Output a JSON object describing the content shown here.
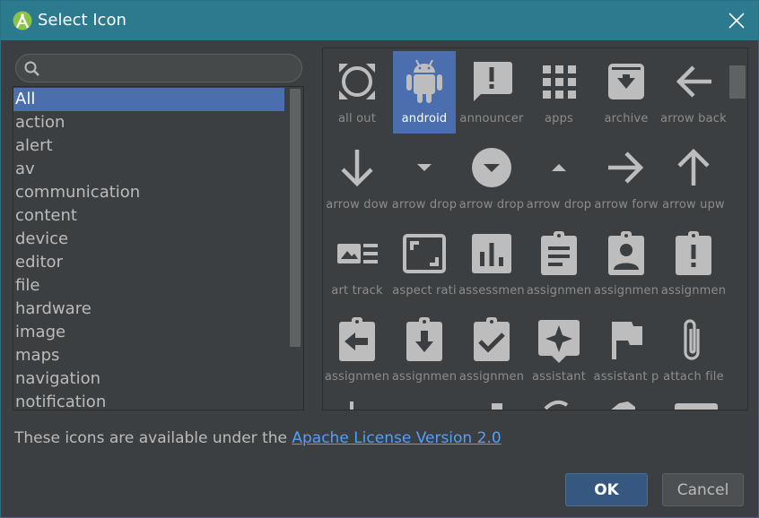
{
  "window": {
    "title": "Select Icon",
    "logo_icon": "android-studio-icon",
    "close_icon": "close-icon"
  },
  "search": {
    "value": "",
    "placeholder": "",
    "icon": "search-icon"
  },
  "categories": [
    {
      "label": "All",
      "selected": true
    },
    {
      "label": "action"
    },
    {
      "label": "alert"
    },
    {
      "label": "av"
    },
    {
      "label": "communication"
    },
    {
      "label": "content"
    },
    {
      "label": "device"
    },
    {
      "label": "editor"
    },
    {
      "label": "file"
    },
    {
      "label": "hardware"
    },
    {
      "label": "image"
    },
    {
      "label": "maps"
    },
    {
      "label": "navigation"
    },
    {
      "label": "notification"
    }
  ],
  "icons": [
    {
      "label": "all out",
      "icon": "all-out-icon"
    },
    {
      "label": "android",
      "icon": "android-icon",
      "selected": true
    },
    {
      "label": "announcer",
      "icon": "announcement-icon"
    },
    {
      "label": "apps",
      "icon": "apps-icon"
    },
    {
      "label": "archive",
      "icon": "archive-icon"
    },
    {
      "label": "arrow back",
      "icon": "arrow-back-icon"
    },
    {
      "label": "arrow dow",
      "icon": "arrow-downward-icon"
    },
    {
      "label": "arrow drop",
      "icon": "arrow-drop-down-icon"
    },
    {
      "label": "arrow drop",
      "icon": "arrow-drop-down-circle-icon"
    },
    {
      "label": "arrow drop",
      "icon": "arrow-drop-up-icon"
    },
    {
      "label": "arrow forw",
      "icon": "arrow-forward-icon"
    },
    {
      "label": "arrow upw",
      "icon": "arrow-upward-icon"
    },
    {
      "label": "art track",
      "icon": "art-track-icon"
    },
    {
      "label": "aspect rati",
      "icon": "aspect-ratio-icon"
    },
    {
      "label": "assessmen",
      "icon": "assessment-icon"
    },
    {
      "label": "assignmen",
      "icon": "assignment-icon"
    },
    {
      "label": "assignmen",
      "icon": "assignment-ind-icon"
    },
    {
      "label": "assignmen",
      "icon": "assignment-late-icon"
    },
    {
      "label": "assignmen",
      "icon": "assignment-return-icon"
    },
    {
      "label": "assignmen",
      "icon": "assignment-returned-icon"
    },
    {
      "label": "assignmen",
      "icon": "assignment-turned-in-icon"
    },
    {
      "label": "assistant",
      "icon": "assistant-icon"
    },
    {
      "label": "assistant p",
      "icon": "assistant-photo-icon"
    },
    {
      "label": "attach file",
      "icon": "attach-file-icon"
    }
  ],
  "license": {
    "text": "These icons are available under the ",
    "link": "Apache License Version 2.0"
  },
  "buttons": {
    "ok": "OK",
    "cancel": "Cancel"
  },
  "colors": {
    "titlebar": "#2b7a8e",
    "background": "#3c3f41",
    "selection": "#4b6eaf",
    "icon_fill": "#bdbdbd",
    "link": "#589df6"
  }
}
